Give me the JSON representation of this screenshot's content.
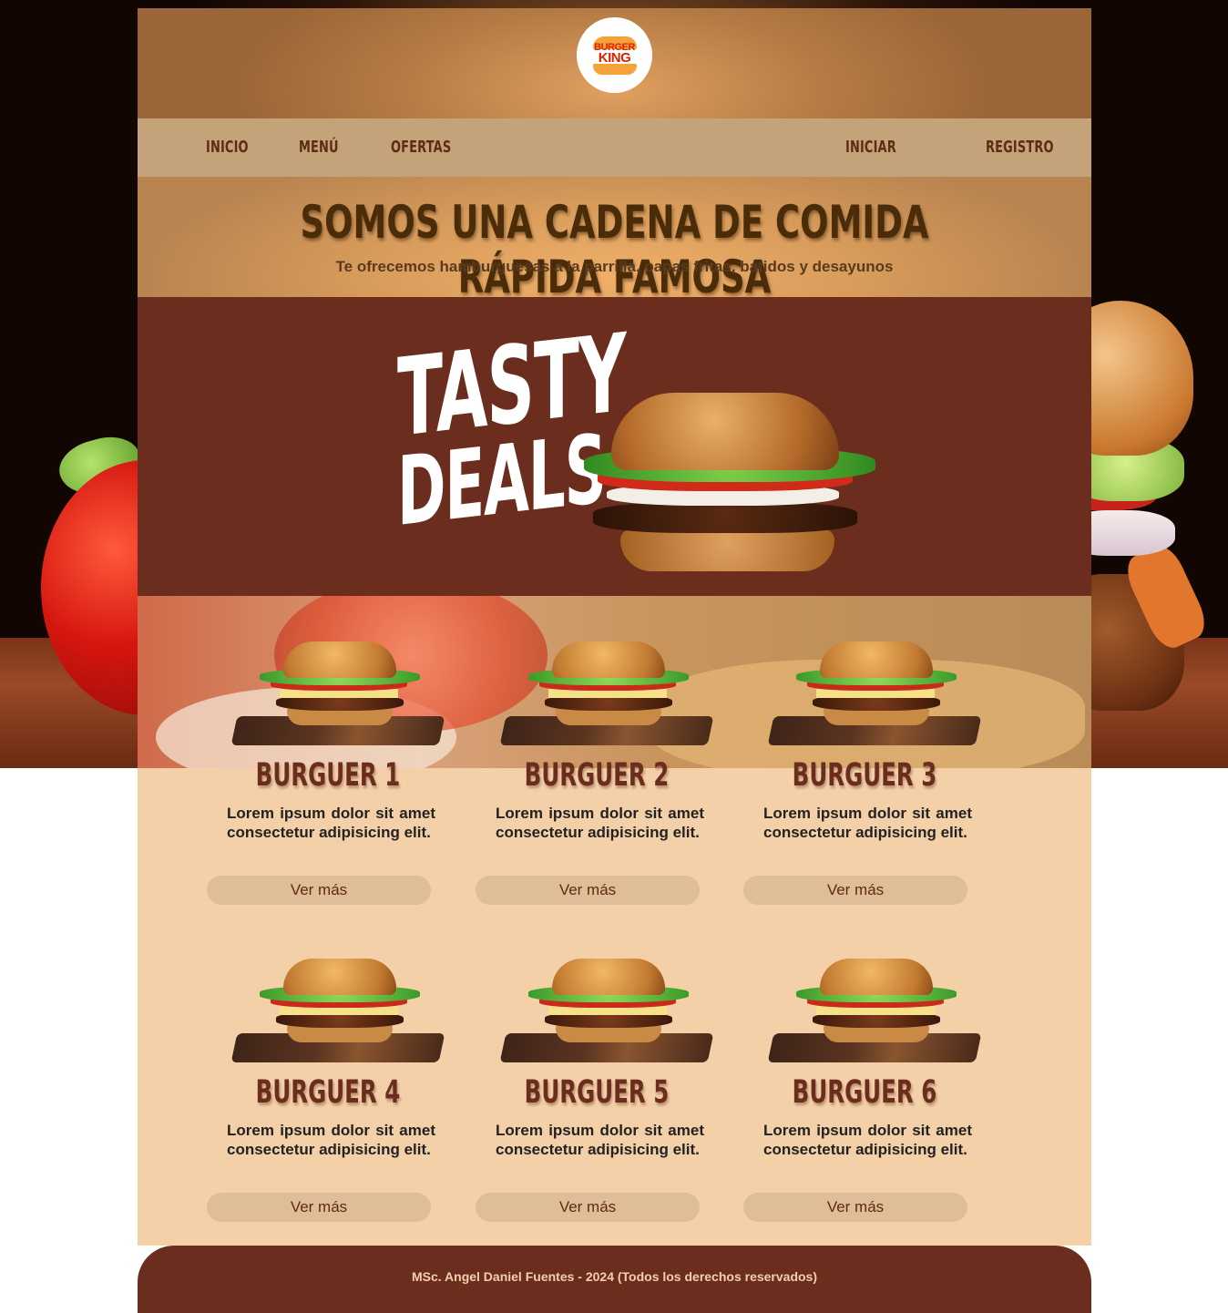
{
  "brand": {
    "logo_line1": "BURGER",
    "logo_line2": "KING",
    "colors": {
      "brown": "#6b2e1e",
      "cream": "#f3d0a8",
      "tan": "#c4a37a",
      "red": "#d62300",
      "orange": "#f5a23a"
    }
  },
  "nav": {
    "items": [
      "INICIO",
      "MENÚ",
      "OFERTAS",
      "INICIAR",
      "REGISTRO"
    ]
  },
  "hero": {
    "title": "SOMOS UNA CADENA DE COMIDA RÁPIDA FAMOSA",
    "subtitle": "Te ofrecemos hamburguesas a la parrilla, papas fritas, batidos y desayunos"
  },
  "banner": {
    "word1": "TASTY",
    "word2": "DEALS"
  },
  "products": [
    {
      "title": "BURGUER 1",
      "description": "Lorem ipsum dolor sit amet consectetur adipisicing elit.",
      "button": "Ver más"
    },
    {
      "title": "BURGUER 2",
      "description": "Lorem ipsum dolor sit amet consectetur adipisicing elit.",
      "button": "Ver más"
    },
    {
      "title": "BURGUER 3",
      "description": "Lorem ipsum dolor sit amet consectetur adipisicing elit.",
      "button": "Ver más"
    },
    {
      "title": "BURGUER 4",
      "description": "Lorem ipsum dolor sit amet consectetur adipisicing elit.",
      "button": "Ver más"
    },
    {
      "title": "BURGUER 5",
      "description": "Lorem ipsum dolor sit amet consectetur adipisicing elit.",
      "button": "Ver más"
    },
    {
      "title": "BURGUER 6",
      "description": "Lorem ipsum dolor sit amet consectetur adipisicing elit.",
      "button": "Ver más"
    }
  ],
  "footer": {
    "text": "MSc. Angel Daniel Fuentes - 2024 (Todos los derechos reservados)"
  }
}
